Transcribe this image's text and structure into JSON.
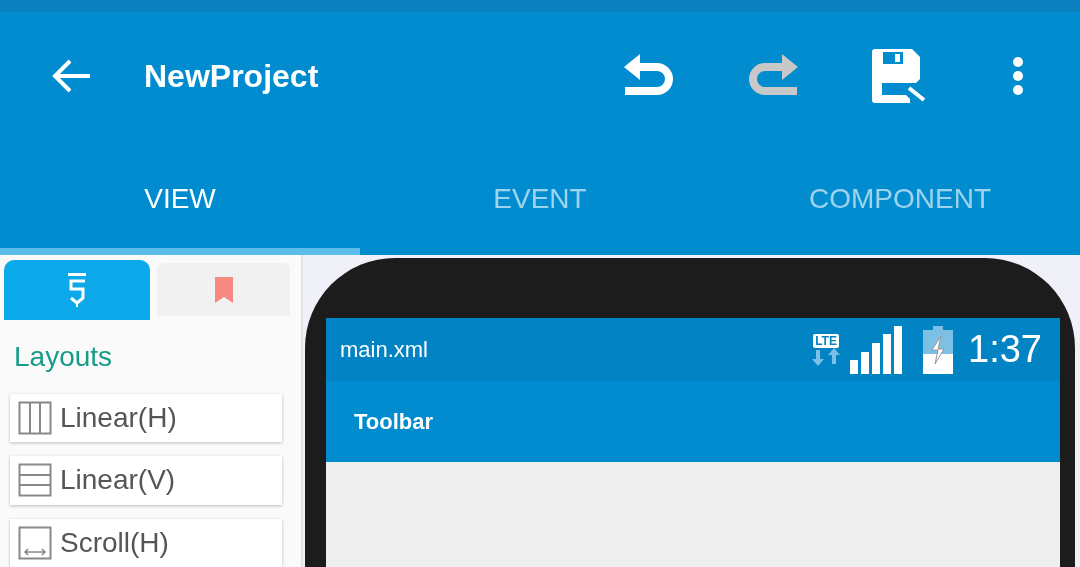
{
  "app_bar": {
    "title": "NewProject",
    "actions": [
      {
        "kind": "undo",
        "disabled": false
      },
      {
        "kind": "redo",
        "disabled": true
      },
      {
        "kind": "save",
        "disabled": false
      },
      {
        "kind": "more",
        "disabled": false
      }
    ]
  },
  "tabs": [
    {
      "label": "VIEW",
      "selected": true
    },
    {
      "label": "EVENT",
      "selected": false
    },
    {
      "label": "COMPONENT",
      "selected": false
    }
  ],
  "palette": {
    "tabs": [
      {
        "kind": "widgets",
        "selected": true
      },
      {
        "kind": "bookmark",
        "selected": false
      }
    ],
    "section_title": "Layouts",
    "items": [
      {
        "kind": "linear_h",
        "label": "Linear(H)"
      },
      {
        "kind": "linear_v",
        "label": "Linear(V)"
      },
      {
        "kind": "scroll_h",
        "label": "Scroll(H)"
      }
    ]
  },
  "preview": {
    "file_name": "main.xml",
    "network": "LTE",
    "time": "1:37",
    "toolbar_title": "Toolbar"
  }
}
